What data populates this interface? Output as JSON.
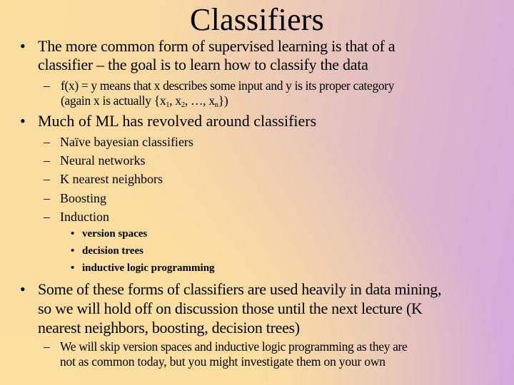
{
  "slide": {
    "title": "Classifiers",
    "bullets": [
      {
        "marker": "•",
        "lines": [
          "The more common form of supervised learning is that of a",
          "classifier – the goal is to learn how to classify the data"
        ],
        "sub": [
          {
            "marker": "–",
            "line1": "f(x) = y means that x describes some input and y is its proper category",
            "line2_prefix": "(again x is actually {x",
            "sub1": "1",
            "sep1": ", x",
            "sub2": "2",
            "sep2": ", …, x",
            "subn": "n",
            "line2_suffix": "})"
          }
        ]
      },
      {
        "marker": "•",
        "lines": [
          "Much of ML has revolved around classifiers"
        ],
        "sub": [
          {
            "marker": "–",
            "text": "Naïve bayesian classifiers"
          },
          {
            "marker": "–",
            "text": "Neural networks"
          },
          {
            "marker": "–",
            "text": "K nearest neighbors"
          },
          {
            "marker": "–",
            "text": "Boosting"
          },
          {
            "marker": "–",
            "text": "Induction",
            "sub": [
              {
                "marker": "•",
                "text": "version spaces"
              },
              {
                "marker": "•",
                "text": "decision trees"
              },
              {
                "marker": "•",
                "text": "inductive logic programming"
              }
            ]
          }
        ]
      },
      {
        "marker": "•",
        "lines": [
          "Some of these forms of classifiers are used heavily in data mining,",
          "so we will hold off on discussion those until the next lecture (K",
          "nearest neighbors, boosting, decision trees)"
        ],
        "sub": [
          {
            "marker": "–",
            "lines": [
              "We will skip version spaces and inductive logic programming as they are",
              "not as common today, but you might investigate them on your own"
            ]
          }
        ]
      }
    ]
  }
}
